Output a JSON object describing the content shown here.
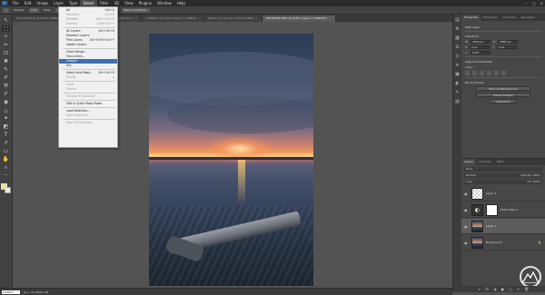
{
  "app": {
    "logo": "Ps"
  },
  "menubar": {
    "items": [
      "File",
      "Edit",
      "Image",
      "Layer",
      "Type",
      "Select",
      "Filter",
      "3D",
      "View",
      "Plugins",
      "Window",
      "Help"
    ],
    "active_index": 5,
    "window_controls": [
      "–",
      "□",
      "×"
    ]
  },
  "optbar": {
    "icon": "marquee-tool-icon",
    "feather_label": "Feather:",
    "feather_value": "0 px",
    "style_label": "Style:",
    "style_value": "Normal",
    "width_label": "Width:",
    "height_label": "Height:",
    "select_mask": "Select and Mask..."
  },
  "tabs": [
    {
      "label": "IMG_9993.psd @ 8.33% (RGB/8*)"
    },
    {
      "label": "20190415 1 copy.psd @ 13.2% (Color Fill...)"
    },
    {
      "label": "Untitled-1 @ 33.3% (Layer 1, RGB/8)"
    },
    {
      "label": "Beach_Sun.psd @ 12.5% (RGB/8)"
    },
    {
      "label": "DSC06763.ARW @ 14.8% (Layer 1, RGB/16*)",
      "active": true
    }
  ],
  "tools": [
    "↖",
    "⬚",
    "✧",
    "✂",
    "⊡",
    "✖",
    "✎",
    "✐",
    "⚒",
    "✐",
    "◉",
    "△",
    "✦",
    "◩",
    "T",
    "↗",
    "▭",
    "✋",
    "⌕",
    "···"
  ],
  "select_menu": [
    {
      "label": "All",
      "shortcut": "Ctrl+A"
    },
    {
      "label": "Deselect",
      "shortcut": "Ctrl+D",
      "disabled": true
    },
    {
      "label": "Reselect",
      "shortcut": "Shift+Ctrl+D",
      "disabled": true
    },
    {
      "label": "Inverse",
      "shortcut": "Shift+Ctrl+I",
      "disabled": true
    },
    {
      "sep": true
    },
    {
      "label": "All Layers",
      "shortcut": "Alt+Ctrl+A"
    },
    {
      "label": "Deselect Layers",
      "shortcut": ""
    },
    {
      "label": "Find Layers",
      "shortcut": "Alt+Shift+Ctrl+F"
    },
    {
      "label": "Isolate Layers",
      "shortcut": ""
    },
    {
      "sep": true
    },
    {
      "label": "Color Range...",
      "shortcut": ""
    },
    {
      "label": "Focus Area...",
      "shortcut": ""
    },
    {
      "label": "Subject",
      "shortcut": "",
      "highlight": true
    },
    {
      "label": "Sky",
      "shortcut": ""
    },
    {
      "sep": true
    },
    {
      "label": "Select and Mask...",
      "shortcut": "Alt+Ctrl+R"
    },
    {
      "label": "Modify",
      "shortcut": "▸",
      "disabled": true
    },
    {
      "sep": true
    },
    {
      "label": "Grow",
      "shortcut": "",
      "disabled": true
    },
    {
      "label": "Similar",
      "shortcut": "",
      "disabled": true
    },
    {
      "sep": true
    },
    {
      "label": "Transform Selection",
      "shortcut": "",
      "disabled": true
    },
    {
      "sep": true
    },
    {
      "label": "Edit in Quick Mask Mode",
      "shortcut": ""
    },
    {
      "sep": true
    },
    {
      "label": "Load Selection...",
      "shortcut": ""
    },
    {
      "label": "Save Selection...",
      "shortcut": "",
      "disabled": true
    },
    {
      "sep": true
    },
    {
      "label": "New 3D Extrusion",
      "shortcut": "",
      "disabled": true
    }
  ],
  "icon_strip": [
    "▤",
    "⚙",
    "▦",
    "☰",
    "◎",
    "≡",
    "▣",
    "◐",
    "✎",
    "▧"
  ],
  "properties": {
    "tabs": [
      "Properties",
      "Histogram",
      "Channels",
      "Paragraph"
    ],
    "active_tab": 0,
    "section_pixel": "Pixel Layer",
    "transform": "Transform",
    "w_label": "W",
    "w_value": "1920 px",
    "h_label": "H",
    "h_value": "2880 px",
    "x_label": "X",
    "x_value": "0 px",
    "y_label": "Y",
    "y_value": "0 px",
    "angle_value": "0.00°",
    "align": "Align and Distribute",
    "align_sub": "Align:",
    "quick_actions": "Quick Actions",
    "btn_remove_bg": "Remove Background",
    "btn_select_subject": "Select Subject",
    "btn_view_more": "View More"
  },
  "layers": {
    "tabs": [
      "Layers",
      "Channels",
      "Paths"
    ],
    "kind": "Kind",
    "blend": "Normal",
    "opacity": "Opacity: 100%",
    "lock": "Lock:",
    "fill": "Fill: 100%",
    "rows": [
      {
        "name": "Layer 2",
        "thumb": "blank"
      },
      {
        "name": "Photo Filter 1",
        "thumb": "adj",
        "mask": true
      },
      {
        "name": "Layer 1",
        "thumb": "photo",
        "selected": true
      },
      {
        "name": "Background",
        "thumb": "photo",
        "lock": "🔒"
      }
    ],
    "bottom_icons": [
      "∞",
      "fx",
      "◑",
      "●",
      "□",
      "+",
      "🗑"
    ]
  },
  "status": {
    "zoom": "14.81%",
    "info": "Doc: 32.2M/87.2M"
  }
}
